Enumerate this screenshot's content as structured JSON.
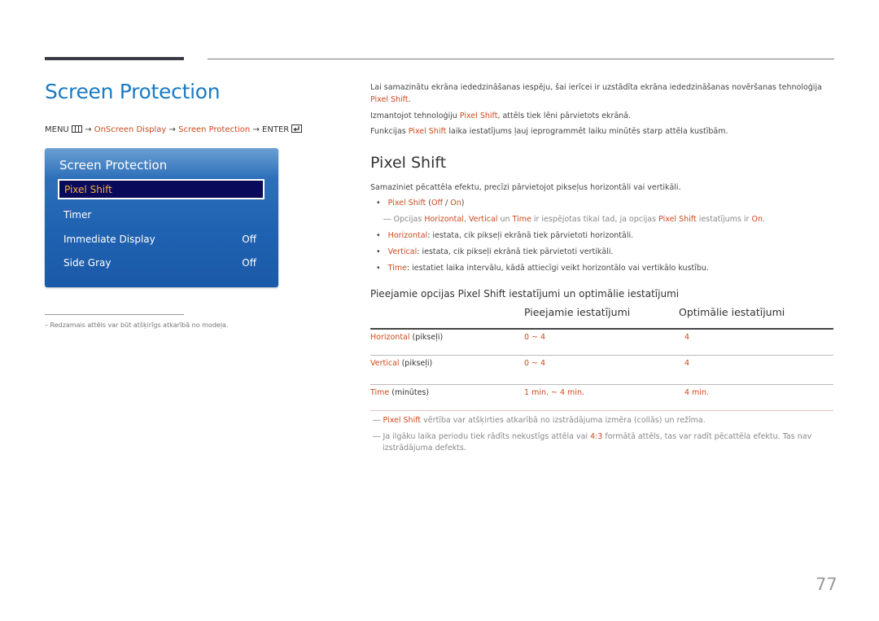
{
  "page": {
    "title": "Screen Protection",
    "page_number": "77"
  },
  "menu_path": {
    "menu_label": "MENU",
    "menu_icon": "menu-grid-icon",
    "arrow": "→",
    "step1": "OnScreen Display",
    "step2": "Screen Protection",
    "enter_label": "ENTER",
    "enter_icon": "enter-icon"
  },
  "osd_menu": {
    "title": "Screen Protection",
    "items": [
      {
        "label": "Pixel Shift",
        "value": "",
        "selected": true
      },
      {
        "label": "Timer",
        "value": ""
      },
      {
        "label": "Immediate Display",
        "value": "Off"
      },
      {
        "label": "Side Gray",
        "value": "Off"
      }
    ]
  },
  "left_footnote": "–  Redzamais attēls var būt atšķirīgs atkarībā no modeļa.",
  "intro": {
    "line1": "Lai samazinātu ekrāna iededzināšanas iespēju, šai ierīcei ir uzstādīta ekrāna iededzināšanas novēršanas tehnoloģija",
    "line1b_hl": "Pixel Shift",
    "line1b_end": ".",
    "line2_a": "Izmantojot tehnoloģiju ",
    "line2_hl": "Pixel Shift",
    "line2_b": ", attēls tiek lēni pārvietots ekrānā.",
    "line3_a": "Funkcijas ",
    "line3_hl": "Pixel Shift",
    "line3_b": " laika iestatījums ļauj ieprogrammēt laiku minūtēs starp attēla kustībām."
  },
  "section": {
    "heading": "Pixel Shift",
    "desc": "Samaziniet pēcattēla efektu, precīzi pārvietojot pikseļus horizontāli vai vertikāli.",
    "bullet1": {
      "hl": "Pixel Shift",
      "open": " (",
      "off": "Off",
      "sep": " / ",
      "on": "On",
      "close": ")"
    },
    "note": {
      "dash": "―",
      "a": " Opcijas ",
      "h1": "Horizontal",
      "b": ", ",
      "h2": "Vertical",
      "c": " un ",
      "h3": "Time",
      "d": " ir iespējotas tikai tad, ja opcijas ",
      "h4": "Pixel Shift",
      "e": " iestatījums ir ",
      "h5": "On",
      "f": "."
    },
    "bullets": [
      {
        "hl": "Horizontal",
        "text": ": iestata, cik pikseļi ekrānā tiek pārvietoti horizontāli."
      },
      {
        "hl": "Vertical",
        "text": ": iestata, cik pikseļi ekrānā tiek pārvietoti vertikāli."
      },
      {
        "hl": "Time",
        "text": ": iestatiet laika intervālu, kādā attiecīgi veikt horizontālo vai vertikālo kustību."
      }
    ]
  },
  "table": {
    "title": "Pieejamie opcijas Pixel Shift iestatījumi un optimālie iestatījumi",
    "headers": [
      "",
      "Pieejamie iestatījumi",
      "Optimālie iestatījumi"
    ],
    "rows": [
      {
        "name": "Horizontal",
        "unit": " (pikseļi)",
        "available": "0 ~ 4",
        "optimal": "4"
      },
      {
        "name": "Vertical",
        "unit": " (pikseļi)",
        "available": "0 ~ 4",
        "optimal": "4"
      },
      {
        "name": "Time",
        "unit": " (minūtes)",
        "available": "1 min. ~ 4 min.",
        "optimal": "4 min."
      }
    ]
  },
  "notes": {
    "n1": {
      "dash": "―",
      "hl": "Pixel Shift",
      "text": " vērtība var atšķirties atkarībā no izstrādājuma izmēra (collās) un režīma."
    },
    "n2": {
      "dash": "―",
      "a": " Ja ilgāku laika periodu tiek rādīts nekustīgs attēla vai ",
      "hl": "4:3",
      "b": " formātā attēls, tas var radīt pēcattēla efektu. Tas nav",
      "line2": "izstrādājuma defekts."
    }
  },
  "colors": {
    "accent_title": "#1a7bc4",
    "highlight": "#cc4a1e",
    "osd_selected_bg": "#0a0a5a",
    "osd_selected_text": "#f0b23a"
  }
}
